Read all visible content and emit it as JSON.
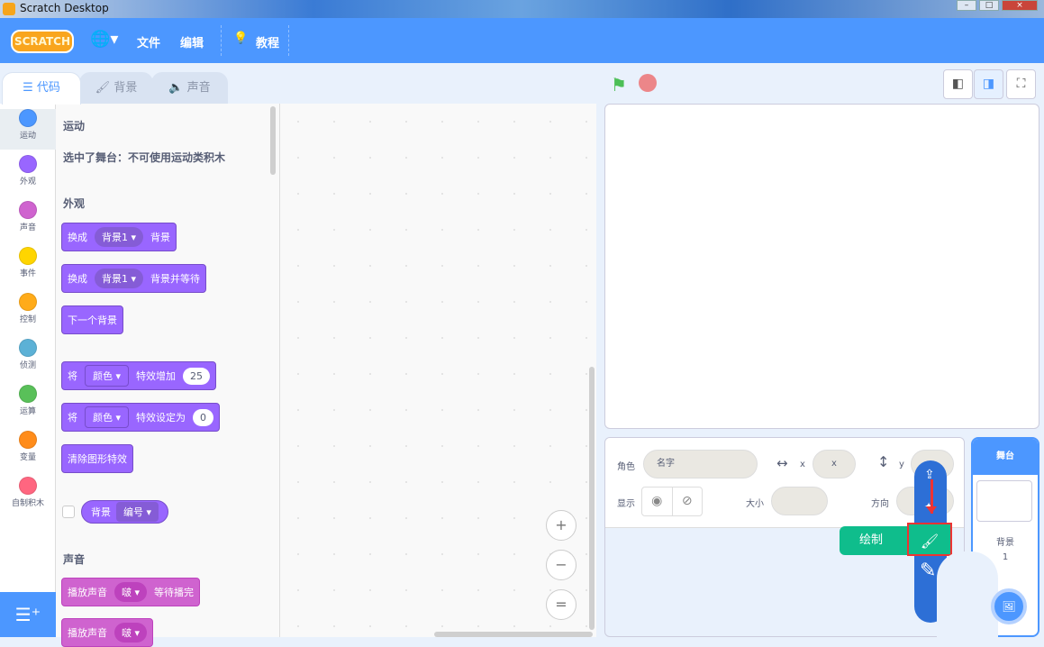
{
  "window": {
    "title": "Scratch Desktop",
    "min": "–",
    "max": "□",
    "close": "×"
  },
  "menubar": {
    "logo": "SCRATCH",
    "language_icon": "globe-icon",
    "file": "文件",
    "edit": "编辑",
    "tutorials": "教程"
  },
  "tabs": [
    {
      "label": "代码",
      "icon": "code-icon"
    },
    {
      "label": "背景",
      "icon": "brush-icon"
    },
    {
      "label": "声音",
      "icon": "speaker-icon"
    }
  ],
  "categories": [
    {
      "label": "运动",
      "color": "#4c97ff"
    },
    {
      "label": "外观",
      "color": "#9966ff"
    },
    {
      "label": "声音",
      "color": "#cf63cf"
    },
    {
      "label": "事件",
      "color": "#ffd500"
    },
    {
      "label": "控制",
      "color": "#ffab19"
    },
    {
      "label": "侦测",
      "color": "#5cb1d6"
    },
    {
      "label": "运算",
      "color": "#59c059"
    },
    {
      "label": "变量",
      "color": "#ff8c1a"
    },
    {
      "label": "自制积木",
      "color": "#ff6680"
    }
  ],
  "palette": {
    "motion_heading": "运动",
    "motion_note": "选中了舞台：不可使用运动类积木",
    "looks_heading": "外观",
    "b1": {
      "a": "换成",
      "drop": "背景1",
      "b": "背景"
    },
    "b2": {
      "a": "换成",
      "drop": "背景1",
      "b": "背景并等待"
    },
    "b3": {
      "a": "下一个背景"
    },
    "b4": {
      "a": "将",
      "drop": "颜色",
      "b": "特效增加",
      "num": "25"
    },
    "b5": {
      "a": "将",
      "drop": "颜色",
      "b": "特效设定为",
      "num": "0"
    },
    "b6": {
      "a": "清除图形特效"
    },
    "r1": {
      "a": "背景",
      "drop": "编号"
    },
    "sound_heading": "声音",
    "s1": {
      "a": "播放声音",
      "drop": "啵",
      "b": "等待播完"
    },
    "s2": {
      "a": "播放声音",
      "drop": "啵"
    }
  },
  "zoom": {
    "in": "+",
    "out": "−",
    "reset": "="
  },
  "sprite_info": {
    "sprite_label": "角色",
    "name_placeholder": "名字",
    "x_label": "x",
    "x_placeholder": "x",
    "y_label": "y",
    "show_label": "显示",
    "size_label": "大小",
    "direction_label": "方向"
  },
  "sprite_menu": {
    "paint_tooltip": "绘制"
  },
  "stage_panel": {
    "title": "舞台",
    "backdrops_label": "背景",
    "backdrops_count": "1"
  },
  "colors": {
    "accent": "#4c97ff",
    "looks": "#9966ff",
    "sound": "#cf63cf",
    "paint": "#0fbd8c",
    "highlight": "#e33333"
  }
}
